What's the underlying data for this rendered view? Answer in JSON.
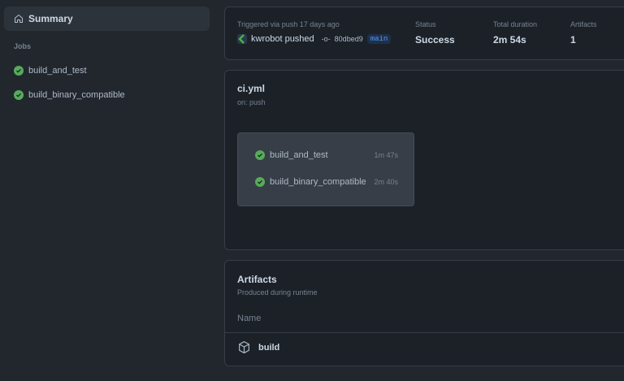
{
  "sidebar": {
    "summary": "Summary",
    "jobs_heading": "Jobs",
    "jobs": [
      {
        "name": "build_and_test",
        "status": "success"
      },
      {
        "name": "build_binary_compatible",
        "status": "success"
      }
    ]
  },
  "run": {
    "triggered": "Triggered via push 17 days ago",
    "actor": "kwrobot pushed",
    "commit": "80dbed9",
    "branch": "main",
    "status_label": "Status",
    "status": "Success",
    "duration_label": "Total duration",
    "duration": "2m 54s",
    "artifacts_label": "Artifacts",
    "artifacts": "1"
  },
  "workflow": {
    "file": "ci.yml",
    "trigger": "on: push",
    "jobs": [
      {
        "name": "build_and_test",
        "time": "1m 47s"
      },
      {
        "name": "build_binary_compatible",
        "time": "2m 40s"
      }
    ]
  },
  "artifacts": {
    "title": "Artifacts",
    "subtitle": "Produced during runtime",
    "column": "Name",
    "items": [
      {
        "name": "build"
      }
    ]
  },
  "colors": {
    "success": "#57ab5a",
    "accent": "#539bf5"
  }
}
